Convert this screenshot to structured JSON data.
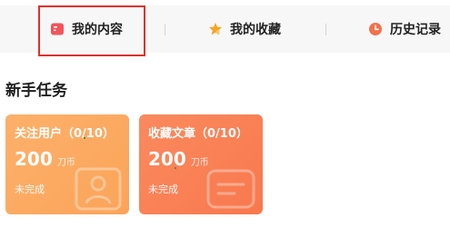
{
  "tabs": [
    {
      "label": "我的内容",
      "icon": "content-card-icon",
      "icon_color": "#f2545b"
    },
    {
      "label": "我的收藏",
      "icon": "star-icon",
      "icon_color": "#f5a623"
    },
    {
      "label": "历史记录",
      "icon": "clock-icon",
      "icon_color": "#f2714b"
    }
  ],
  "section": {
    "title": "新手任务"
  },
  "tasks": [
    {
      "title": "关注用户（0/10）",
      "amount": "200",
      "unit": "刀币",
      "status": "未完成",
      "color": "#fba45a"
    },
    {
      "title": "收藏文章（0/10）",
      "amount": "200",
      "unit": "刀币",
      "status": "未完成",
      "color": "#f9784e"
    }
  ],
  "colors": {
    "highlight": "#e0312a",
    "tab_bg": "#f7f7f8"
  }
}
